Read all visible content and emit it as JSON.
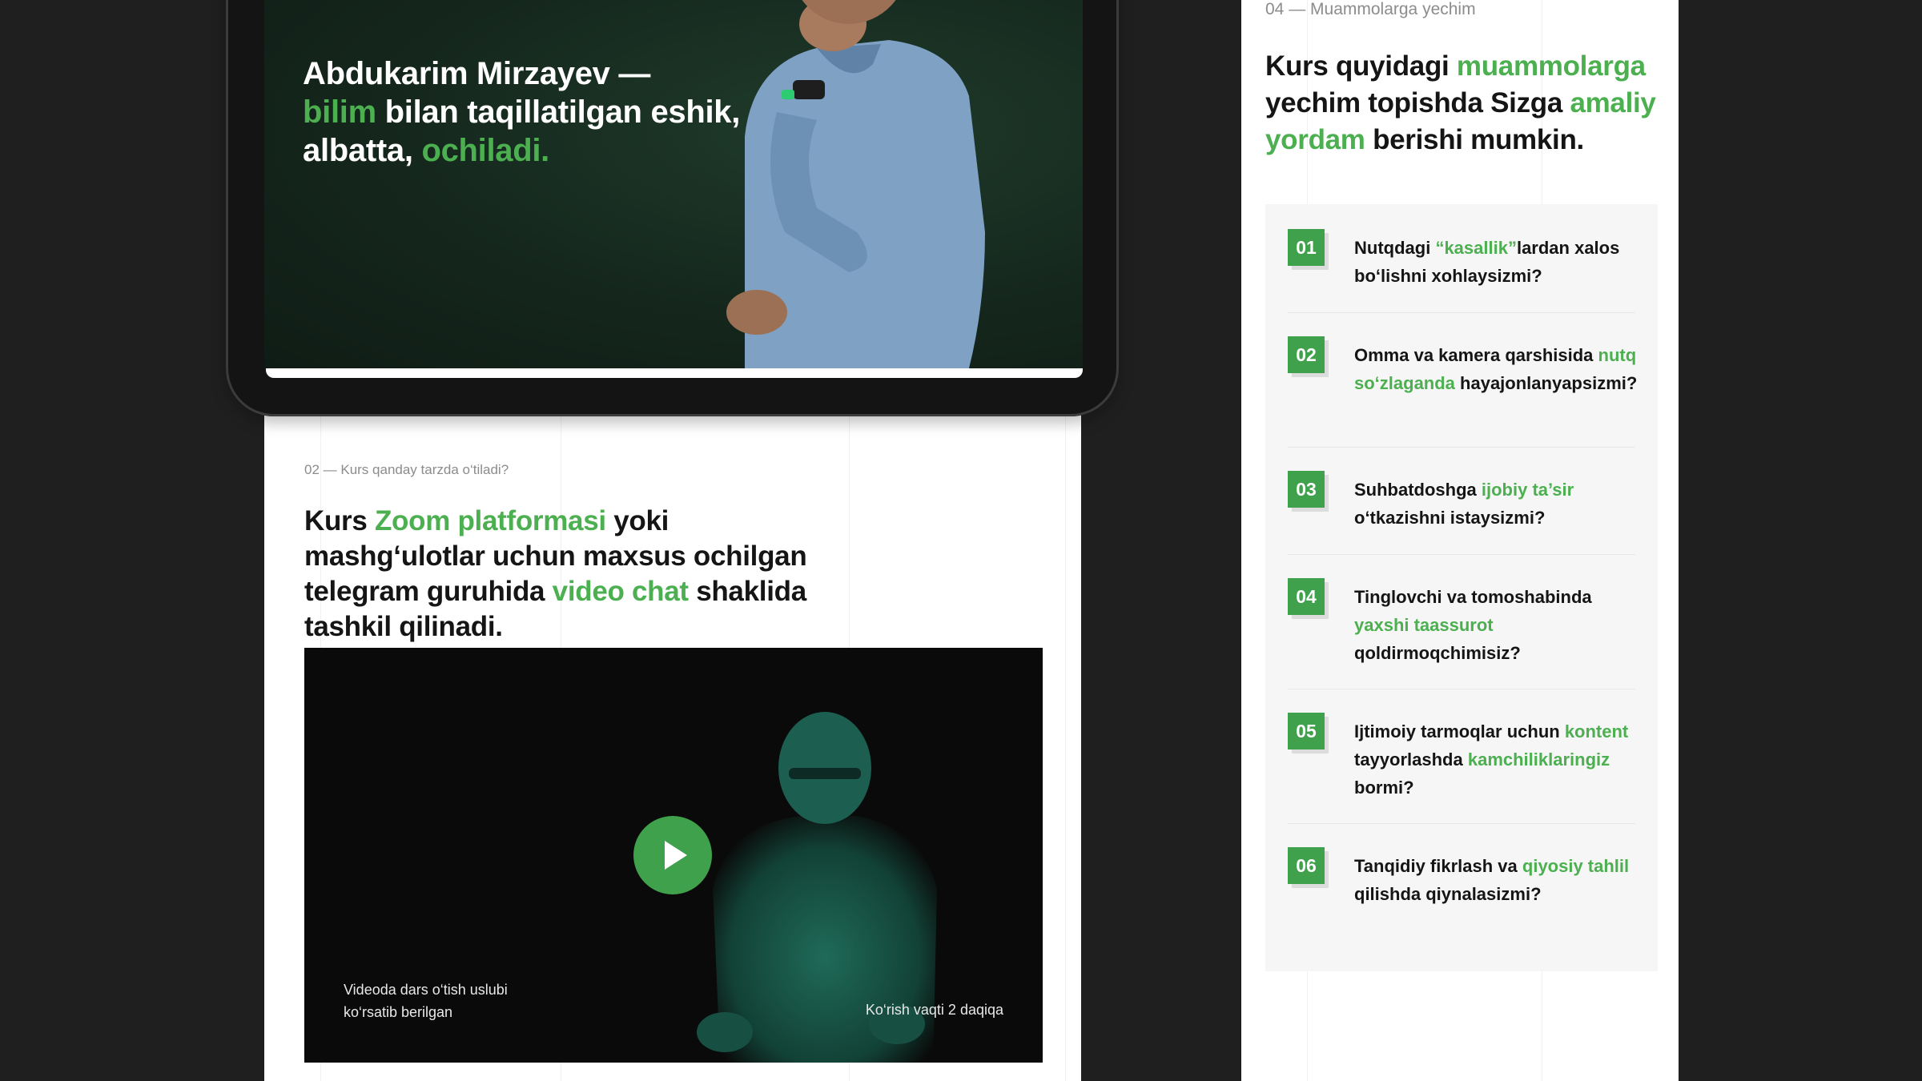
{
  "hero": {
    "name_line": "Abdukarim Mirzayev —",
    "q_green1": "bilim",
    "q_text2": " bilan taqillatilgan eshik,",
    "q_text3": "albatta, ",
    "q_green2": "ochiladi."
  },
  "section2": {
    "label": "02 — Kurs qanday tarzda o‘tiladi?",
    "h_t1": "Kurs ",
    "h_g1": "Zoom platformasi",
    "h_t2": " yoki mashg‘ulotlar uchun maxsus ochilgan telegram guruhida ",
    "h_g2": "video chat",
    "h_t3": " shaklida tashkil qilinadi."
  },
  "video": {
    "caption_line1": "Videoda dars o‘tish uslubi",
    "caption_line2": "ko‘rsatib berilgan",
    "duration": "Ko‘rish vaqti 2 daqiqa"
  },
  "section4": {
    "label": "04 — Muammolarga yechim",
    "h_t1": "Kurs quyidagi ",
    "h_g1": "muammolarga",
    "h_t2": " yechim topishda Sizga ",
    "h_g2": "amaliy yordam",
    "h_t3": " berishi mumkin."
  },
  "questions": [
    {
      "num": "01",
      "p1": "Nutqdagi ",
      "g1": "“kasallik”",
      "p2": "lardan xalos bo‘lishni xohlaysizmi?",
      "g2": "",
      "p3": ""
    },
    {
      "num": "02",
      "p1": "Omma va kamera qarshisida ",
      "g1": "nutq so‘zlaganda",
      "p2": " hayajonlanyapsizmi?",
      "g2": "",
      "p3": ""
    },
    {
      "num": "03",
      "p1": "Suhbatdoshga ",
      "g1": "ijobiy ta’sir",
      "p2": " o‘tkazishni istaysizmi?",
      "g2": "",
      "p3": ""
    },
    {
      "num": "04",
      "p1": "Tinglovchi va tomoshabinda ",
      "g1": "yaxshi taassurot",
      "p2": " qoldirmoqchimisiz?",
      "g2": "",
      "p3": ""
    },
    {
      "num": "05",
      "p1": "Ijtimoiy tarmoqlar uchun ",
      "g1": "kontent",
      "p2": " tayyorlashda ",
      "g2": "kamchiliklaringiz",
      "p3": " bormi?"
    },
    {
      "num": "06",
      "p1": "Tanqidiy fikrlash va ",
      "g1": "qiyosiy tahlil",
      "p2": " qilishda qiynalasizmi?",
      "g2": "",
      "p3": ""
    }
  ],
  "colors": {
    "accent": "#3fa14b",
    "background": "#1f1f1f",
    "card": "#ffffff",
    "panel": "#f6f6f6"
  },
  "icons": {
    "play": "play-icon"
  }
}
